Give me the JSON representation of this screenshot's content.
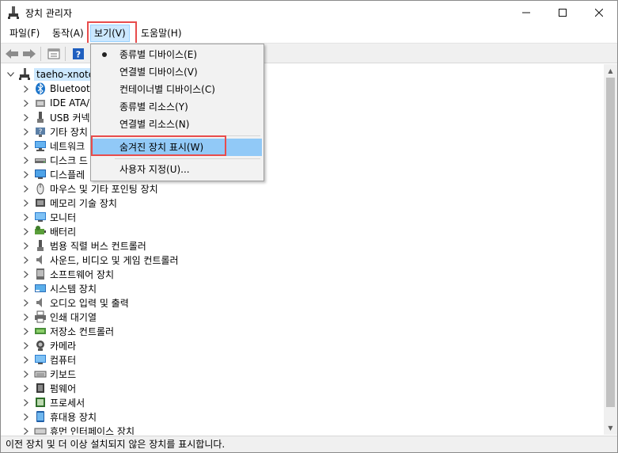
{
  "window": {
    "title": "장치 관리자",
    "controls": {
      "minimize": "—",
      "maximize": "☐",
      "close": "✕"
    }
  },
  "menubar": {
    "file": "파일(F)",
    "action": "동작(A)",
    "view": "보기(V)",
    "help": "도움말(H)"
  },
  "toolbar": {
    "buttons": [
      "back-icon",
      "forward-icon",
      "properties-icon",
      "help-icon"
    ]
  },
  "view_menu": {
    "items": [
      {
        "label": "종류별 디바이스(E)",
        "checked": true
      },
      {
        "label": "연결별 디바이스(V)",
        "checked": false
      },
      {
        "label": "컨테이너별 디바이스(C)",
        "checked": false
      },
      {
        "label": "종류별 리소스(Y)",
        "checked": false
      },
      {
        "label": "연결별 리소스(N)",
        "checked": false
      },
      {
        "label": "숨겨진 장치 표시(W)",
        "checked": false,
        "highlighted": true
      },
      {
        "label": "사용자 지정(U)...",
        "checked": false
      }
    ]
  },
  "tree": {
    "root": "taeho-xnote",
    "items": [
      {
        "label": "Bluetooth",
        "icon": "bluetooth-icon"
      },
      {
        "label": "IDE ATA/",
        "icon": "ide-controller-icon"
      },
      {
        "label": "USB 커넥",
        "icon": "usb-icon"
      },
      {
        "label": "기타 장치",
        "icon": "unknown-device-icon"
      },
      {
        "label": "네트워크",
        "icon": "network-adapter-icon"
      },
      {
        "label": "디스크 드",
        "icon": "disk-drive-icon"
      },
      {
        "label": "디스플레",
        "icon": "display-adapter-icon"
      },
      {
        "label": "마우스 및 기타 포인팅 장치",
        "icon": "mouse-icon"
      },
      {
        "label": "메모리 기술 장치",
        "icon": "memory-icon"
      },
      {
        "label": "모니터",
        "icon": "monitor-icon"
      },
      {
        "label": "배터리",
        "icon": "battery-icon"
      },
      {
        "label": "범용 직렬 버스 컨트롤러",
        "icon": "usb-controller-icon"
      },
      {
        "label": "사운드, 비디오 및 게임 컨트롤러",
        "icon": "speaker-icon"
      },
      {
        "label": "소프트웨어 장치",
        "icon": "software-device-icon"
      },
      {
        "label": "시스템 장치",
        "icon": "system-device-icon"
      },
      {
        "label": "오디오 입력 및 출력",
        "icon": "audio-icon"
      },
      {
        "label": "인쇄 대기열",
        "icon": "printer-icon"
      },
      {
        "label": "저장소 컨트롤러",
        "icon": "storage-controller-icon"
      },
      {
        "label": "카메라",
        "icon": "camera-icon"
      },
      {
        "label": "컴퓨터",
        "icon": "computer-icon"
      },
      {
        "label": "키보드",
        "icon": "keyboard-icon"
      },
      {
        "label": "펌웨어",
        "icon": "firmware-icon"
      },
      {
        "label": "프로세서",
        "icon": "processor-icon"
      },
      {
        "label": "휴대용 장치",
        "icon": "portable-device-icon"
      },
      {
        "label": "휴먼 인터페이스 장치",
        "icon": "hid-icon"
      }
    ]
  },
  "statusbar": {
    "text": "이전 장치 및 더 이상 설치되지 않은 장치를 표시합니다."
  },
  "colors": {
    "highlight_border": "#e84c4c",
    "selection": "#cce8ff",
    "menu_hover": "#91c9f7"
  }
}
